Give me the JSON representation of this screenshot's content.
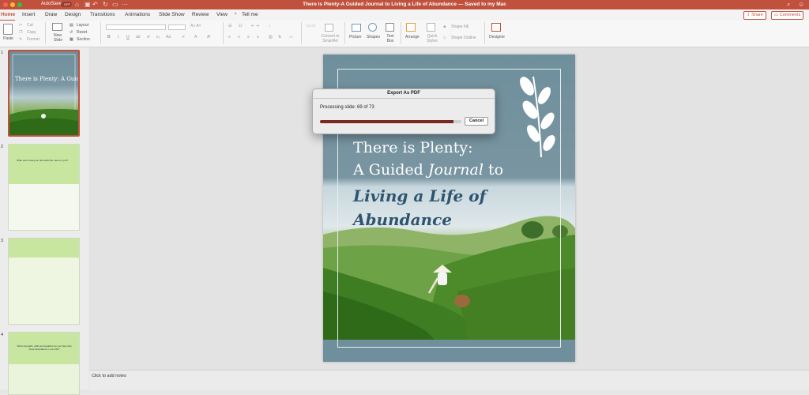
{
  "titlebar": {
    "autosave_label": "AutoSave",
    "autosave_state": "OFF",
    "document_title": "There is Plenty-A Guided Journal to Living a Life of Abundance — Saved to my Mac"
  },
  "tabs": [
    {
      "label": "Home",
      "active": true
    },
    {
      "label": "Insert"
    },
    {
      "label": "Draw"
    },
    {
      "label": "Design"
    },
    {
      "label": "Transitions"
    },
    {
      "label": "Animations"
    },
    {
      "label": "Slide Show"
    },
    {
      "label": "Review"
    },
    {
      "label": "View"
    },
    {
      "label": "Tell me"
    }
  ],
  "header_buttons": {
    "share": "Share",
    "comments": "Comments"
  },
  "ribbon": {
    "paste": "Paste",
    "cut": "Cut",
    "copy": "Copy",
    "format": "Format",
    "new_slide": "New Slide",
    "layout": "Layout",
    "reset": "Reset",
    "section": "Section",
    "convert_smartart": "Convert to SmartArt",
    "picture": "Picture",
    "shapes": "Shapes",
    "text_box": "Text Box",
    "arrange": "Arrange",
    "quick_styles": "Quick Styles",
    "shape_fill": "Shape Fill",
    "shape_outline": "Shape Outline",
    "designer": "Designer"
  },
  "slides": [
    {
      "number": "1",
      "title": "There is Plenty: A Guided Journal to Living a Life of Abundance"
    },
    {
      "number": "2",
      "prompt": "What does having an abundant life mean to you?"
    },
    {
      "number": "3"
    },
    {
      "number": "4",
      "prompt": "What strengths, skills and qualities do you have that show abundance in your life?"
    }
  ],
  "main_slide": {
    "title_line1": "There is Plenty:",
    "title_line2_a": "A Guided ",
    "title_line2_b": "Journal",
    "title_line2_c": " to",
    "title_line3": "Living a Life of",
    "title_line4": "Abundance"
  },
  "dialog": {
    "title": "Export As PDF",
    "message": "Processing slide: 69 of 73",
    "progress": 0.945,
    "cancel": "Cancel"
  },
  "notes_placeholder": "Click to add notes",
  "colors": {
    "accent": "#c0513d",
    "slide_teal": "#6f8f9c",
    "title_blue": "#2e5470",
    "journal_green": "#c9e6a0"
  }
}
